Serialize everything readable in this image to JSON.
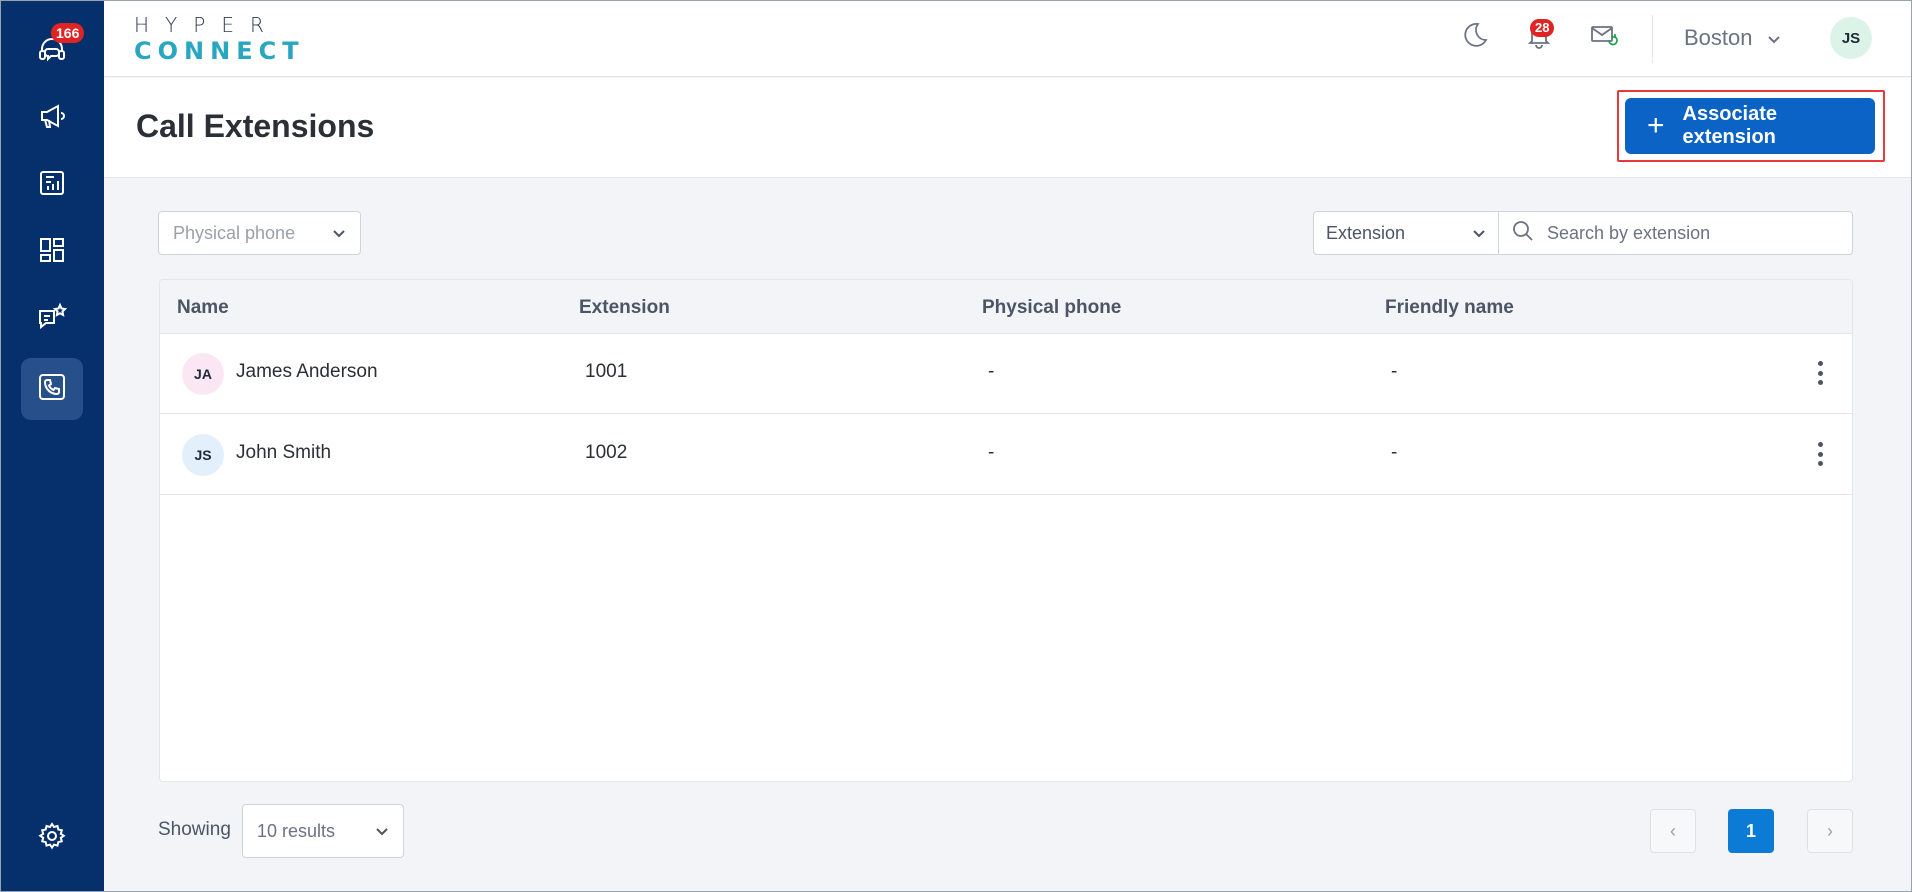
{
  "sidebar": {
    "support_badge": "166",
    "icons": [
      "headset-icon",
      "megaphone-icon",
      "report-icon",
      "dashboard-icon",
      "chat-star-icon",
      "phone-icon",
      "gear-icon"
    ]
  },
  "header": {
    "logo_top": "HYPER",
    "logo_bottom": "CONNECT",
    "notification_badge": "28",
    "location": "Boston",
    "user_initials": "JS"
  },
  "page": {
    "title": "Call Extensions",
    "associate_button": "Associate extension"
  },
  "filters": {
    "physical_phone_placeholder": "Physical phone",
    "field_select": "Extension",
    "search_placeholder": "Search by extension"
  },
  "table": {
    "columns": [
      "Name",
      "Extension",
      "Physical phone",
      "Friendly name"
    ],
    "rows": [
      {
        "initials": "JA",
        "name": "James Anderson",
        "extension": "1001",
        "physical_phone": "-",
        "friendly_name": "-",
        "avatar_color": "#fbe7f3"
      },
      {
        "initials": "JS",
        "name": "John Smith",
        "extension": "1002",
        "physical_phone": "-",
        "friendly_name": "-",
        "avatar_color": "#e3f0fb"
      }
    ]
  },
  "footer": {
    "showing_label": "Showing",
    "page_size": "10 results",
    "prev": "‹",
    "current_page": "1",
    "next": "›"
  },
  "colors": {
    "sidebar": "#06306b",
    "primary": "#0b63c5",
    "highlight_outline": "#e5393d",
    "badge": "#e02424"
  }
}
